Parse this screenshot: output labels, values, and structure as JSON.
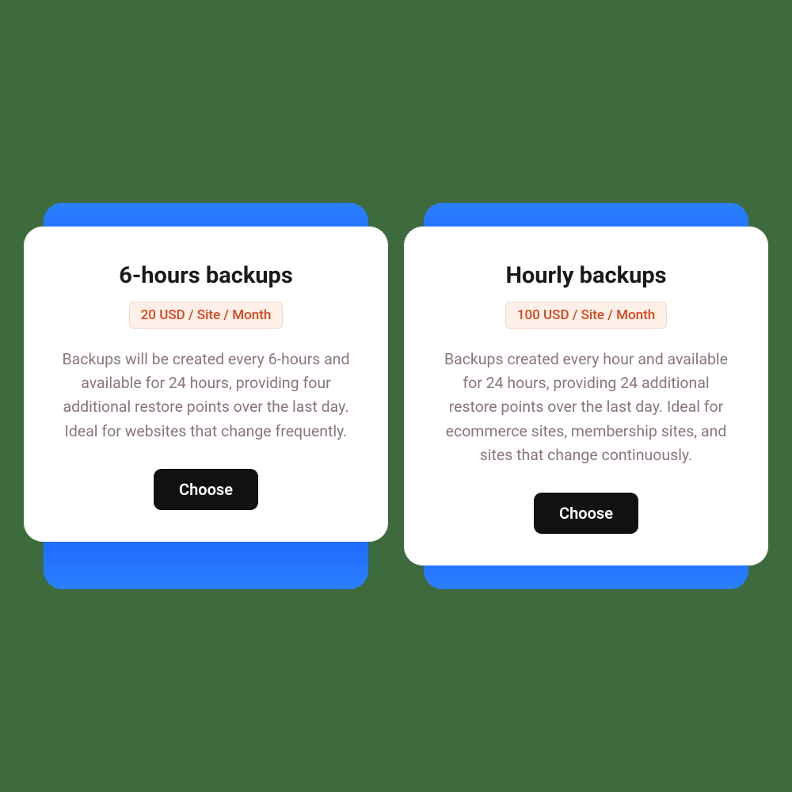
{
  "plans": [
    {
      "title": "6-hours backups",
      "price": "20 USD / Site / Month",
      "description": "Backups will be created every 6-hours and available for 24 hours, providing four additional restore points over the last day. Ideal for websites that change frequently.",
      "button": "Choose"
    },
    {
      "title": "Hourly backups",
      "price": "100 USD / Site / Month",
      "description": "Backups created every hour and available for 24 hours, providing 24 additional restore points over the last day. Ideal for ecommerce sites, membership sites, and sites that change continuously.",
      "button": "Choose"
    }
  ]
}
